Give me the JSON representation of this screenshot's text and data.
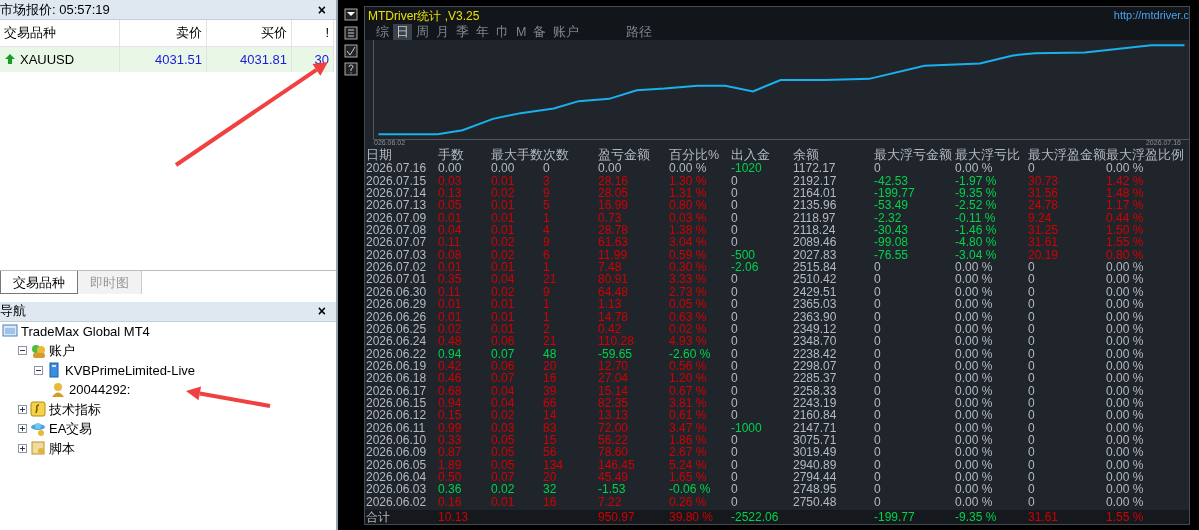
{
  "market_watch": {
    "title": "市场报价: 05:57:19",
    "close": "×",
    "columns": [
      "交易品种",
      "卖价",
      "买价",
      "!"
    ],
    "rows": [
      {
        "symbol": "XAUUSD",
        "bid": "4031.51",
        "ask": "4031.81",
        "spread": "30",
        "selected": true
      }
    ]
  },
  "left_tabs": [
    {
      "label": "交易品种",
      "selected": true
    },
    {
      "label": "即时图",
      "selected": false
    }
  ],
  "navigator": {
    "title": "导航",
    "close": "×",
    "tree": [
      {
        "label": "TradeMax Global MT4",
        "kind": "terminal",
        "children": [
          {
            "label": "账户",
            "kind": "accounts",
            "expanded": true,
            "children": [
              {
                "label": "KVBPrimeLimited-Live",
                "kind": "server",
                "expanded": true,
                "children": [
                  {
                    "label": "20044292:",
                    "kind": "account"
                  }
                ]
              }
            ]
          },
          {
            "label": "技术指标",
            "kind": "indicators",
            "expanded": false
          },
          {
            "label": "EA交易",
            "kind": "experts",
            "expanded": false
          },
          {
            "label": "脚本",
            "kind": "scripts",
            "expanded": false
          }
        ]
      }
    ]
  },
  "stats": {
    "title": "MTDriver统计 ,V3.25",
    "link": "http://mtdriver.c",
    "menu": [
      {
        "label": "综",
        "selected": false
      },
      {
        "label": "日",
        "selected": true
      },
      {
        "label": "周",
        "selected": false
      },
      {
        "label": "月",
        "selected": false
      },
      {
        "label": "季",
        "selected": false
      },
      {
        "label": "年",
        "selected": false
      },
      {
        "label": "巾",
        "selected": false
      },
      {
        "label": "M",
        "selected": false
      },
      {
        "label": "备",
        "selected": false
      },
      {
        "label": "账户",
        "selected": false
      },
      {
        "label": "路径",
        "selected": false
      }
    ],
    "chart": {
      "start_label": "026.06.02",
      "end_label": "2026.07.16"
    },
    "columns": [
      "日期",
      "手数",
      "最大手数",
      "次数",
      "盈亏金额",
      "百分比%",
      "出入金",
      "余额",
      "最大浮亏金额",
      "最大浮亏比",
      "最大浮盈金额",
      "最大浮盈比例"
    ],
    "rows": [
      {
        "cells": [
          "2026.07.16",
          "0.00",
          "0.00",
          "0",
          "0.00",
          "0.00 %",
          "-1020",
          "1172.17",
          "0",
          "0.00 %",
          "0",
          "0.00 %"
        ],
        "kind": "flat",
        "flow_change": true,
        "floating": false
      },
      {
        "cells": [
          "2026.07.15",
          "0.03",
          "0.01",
          "3",
          "28.16",
          "1.30 %",
          "0",
          "2192.17",
          "-42.53",
          "-1.97 %",
          "30.73",
          "1.42 %"
        ],
        "kind": "profit",
        "flow_change": false,
        "floating": true
      },
      {
        "cells": [
          "2026.07.14",
          "0.13",
          "0.02",
          "9",
          "28.05",
          "1.31 %",
          "0",
          "2164.01",
          "-199.77",
          "-9.35 %",
          "31.56",
          "1.48 %"
        ],
        "kind": "profit",
        "flow_change": false,
        "floating": true
      },
      {
        "cells": [
          "2026.07.13",
          "0.05",
          "0.01",
          "5",
          "16.99",
          "0.80 %",
          "0",
          "2135.96",
          "-53.49",
          "-2.52 %",
          "24.78",
          "1.17 %"
        ],
        "kind": "profit",
        "flow_change": false,
        "floating": true
      },
      {
        "cells": [
          "2026.07.09",
          "0.01",
          "0.01",
          "1",
          "0.73",
          "0.03 %",
          "0",
          "2118.97",
          "-2.32",
          "-0.11 %",
          "9.24",
          "0.44 %"
        ],
        "kind": "profit",
        "flow_change": false,
        "floating": true
      },
      {
        "cells": [
          "2026.07.08",
          "0.04",
          "0.01",
          "4",
          "28.78",
          "1.38 %",
          "0",
          "2118.24",
          "-30.43",
          "-1.46 %",
          "31.25",
          "1.50 %"
        ],
        "kind": "profit",
        "flow_change": false,
        "floating": true
      },
      {
        "cells": [
          "2026.07.07",
          "0.11",
          "0.02",
          "9",
          "61.63",
          "3.04 %",
          "0",
          "2089.46",
          "-99.08",
          "-4.80 %",
          "31.61",
          "1.55 %"
        ],
        "kind": "profit",
        "flow_change": false,
        "floating": true
      },
      {
        "cells": [
          "2026.07.03",
          "0.08",
          "0.02",
          "6",
          "11.99",
          "0.59 %",
          "-500",
          "2027.83",
          "-76.55",
          "-3.04 %",
          "20.19",
          "0.80 %"
        ],
        "kind": "profit",
        "flow_change": true,
        "floating": true
      },
      {
        "cells": [
          "2026.07.02",
          "0.01",
          "0.01",
          "1",
          "7.48",
          "0.30 %",
          "-2.06",
          "2515.84",
          "0",
          "0.00 %",
          "0",
          "0.00 %"
        ],
        "kind": "profit",
        "flow_change": true,
        "floating": false
      },
      {
        "cells": [
          "2026.07.01",
          "0.35",
          "0.04",
          "21",
          "80.91",
          "3.33 %",
          "0",
          "2510.42",
          "0",
          "0.00 %",
          "0",
          "0.00 %"
        ],
        "kind": "profit",
        "flow_change": false,
        "floating": false
      },
      {
        "cells": [
          "2026.06.30",
          "0.11",
          "0.02",
          "9",
          "64.48",
          "2.73 %",
          "0",
          "2429.51",
          "0",
          "0.00 %",
          "0",
          "0.00 %"
        ],
        "kind": "profit",
        "flow_change": false,
        "floating": false
      },
      {
        "cells": [
          "2026.06.29",
          "0.01",
          "0.01",
          "1",
          "1.13",
          "0.05 %",
          "0",
          "2365.03",
          "0",
          "0.00 %",
          "0",
          "0.00 %"
        ],
        "kind": "profit",
        "flow_change": false,
        "floating": false
      },
      {
        "cells": [
          "2026.06.26",
          "0.01",
          "0.01",
          "1",
          "14.78",
          "0.63 %",
          "0",
          "2363.90",
          "0",
          "0.00 %",
          "0",
          "0.00 %"
        ],
        "kind": "profit",
        "flow_change": false,
        "floating": false
      },
      {
        "cells": [
          "2026.06.25",
          "0.02",
          "0.01",
          "2",
          "0.42",
          "0.02 %",
          "0",
          "2349.12",
          "0",
          "0.00 %",
          "0",
          "0.00 %"
        ],
        "kind": "profit",
        "flow_change": false,
        "floating": false
      },
      {
        "cells": [
          "2026.06.24",
          "0.48",
          "0.06",
          "21",
          "110.28",
          "4.93 %",
          "0",
          "2348.70",
          "0",
          "0.00 %",
          "0",
          "0.00 %"
        ],
        "kind": "profit",
        "flow_change": false,
        "floating": false
      },
      {
        "cells": [
          "2026.06.22",
          "0.94",
          "0.07",
          "48",
          "-59.65",
          "-2.60 %",
          "0",
          "2238.42",
          "0",
          "0.00 %",
          "0",
          "0.00 %"
        ],
        "kind": "loss",
        "flow_change": false,
        "floating": false
      },
      {
        "cells": [
          "2026.06.19",
          "0.42",
          "0.06",
          "20",
          "12.70",
          "0.56 %",
          "0",
          "2298.07",
          "0",
          "0.00 %",
          "0",
          "0.00 %"
        ],
        "kind": "profit",
        "flow_change": false,
        "floating": false
      },
      {
        "cells": [
          "2026.06.18",
          "0.46",
          "0.07",
          "16",
          "27.04",
          "1.20 %",
          "0",
          "2285.37",
          "0",
          "0.00 %",
          "0",
          "0.00 %"
        ],
        "kind": "profit",
        "flow_change": false,
        "floating": false
      },
      {
        "cells": [
          "2026.06.17",
          "0.68",
          "0.04",
          "39",
          "15.14",
          "0.67 %",
          "0",
          "2258.33",
          "0",
          "0.00 %",
          "0",
          "0.00 %"
        ],
        "kind": "profit",
        "flow_change": false,
        "floating": false
      },
      {
        "cells": [
          "2026.06.15",
          "0.94",
          "0.04",
          "66",
          "82.35",
          "3.81 %",
          "0",
          "2243.19",
          "0",
          "0.00 %",
          "0",
          "0.00 %"
        ],
        "kind": "profit",
        "flow_change": false,
        "floating": false
      },
      {
        "cells": [
          "2026.06.12",
          "0.15",
          "0.02",
          "14",
          "13.13",
          "0.61 %",
          "0",
          "2160.84",
          "0",
          "0.00 %",
          "0",
          "0.00 %"
        ],
        "kind": "profit",
        "flow_change": false,
        "floating": false
      },
      {
        "cells": [
          "2026.06.11",
          "0.99",
          "0.03",
          "83",
          "72.00",
          "3.47 %",
          "-1000",
          "2147.71",
          "0",
          "0.00 %",
          "0",
          "0.00 %"
        ],
        "kind": "profit",
        "flow_change": true,
        "floating": false
      },
      {
        "cells": [
          "2026.06.10",
          "0.33",
          "0.05",
          "15",
          "56.22",
          "1.86 %",
          "0",
          "3075.71",
          "0",
          "0.00 %",
          "0",
          "0.00 %"
        ],
        "kind": "profit",
        "flow_change": false,
        "floating": false
      },
      {
        "cells": [
          "2026.06.09",
          "0.87",
          "0.05",
          "56",
          "78.60",
          "2.67 %",
          "0",
          "3019.49",
          "0",
          "0.00 %",
          "0",
          "0.00 %"
        ],
        "kind": "profit",
        "flow_change": false,
        "floating": false
      },
      {
        "cells": [
          "2026.06.05",
          "1.89",
          "0.05",
          "134",
          "146.45",
          "5.24 %",
          "0",
          "2940.89",
          "0",
          "0.00 %",
          "0",
          "0.00 %"
        ],
        "kind": "profit",
        "flow_change": false,
        "floating": false
      },
      {
        "cells": [
          "2026.06.04",
          "0.50",
          "0.07",
          "20",
          "45.49",
          "1.65 %",
          "0",
          "2794.44",
          "0",
          "0.00 %",
          "0",
          "0.00 %"
        ],
        "kind": "profit",
        "flow_change": false,
        "floating": false
      },
      {
        "cells": [
          "2026.06.03",
          "0.36",
          "0.02",
          "32",
          "-1.53",
          "-0.06 %",
          "0",
          "2748.95",
          "0",
          "0.00 %",
          "0",
          "0.00 %"
        ],
        "kind": "loss",
        "flow_change": false,
        "floating": false
      },
      {
        "cells": [
          "2026.06.02",
          "0.16",
          "0.01",
          "16",
          "7.22",
          "0.26 %",
          "0",
          "2750.48",
          "0",
          "0.00 %",
          "0",
          "0.00 %"
        ],
        "kind": "profit",
        "flow_change": false,
        "floating": false
      }
    ],
    "total": {
      "label": "合计",
      "lots": "10.13",
      "profit": "950.97",
      "pct": "39.80 %",
      "flow": "-2522.06",
      "max_float_loss": "-199.77",
      "max_float_loss_pct": "-9.35 %",
      "max_float_profit": "31.61",
      "max_float_profit_pct": "1.55 %"
    }
  }
}
